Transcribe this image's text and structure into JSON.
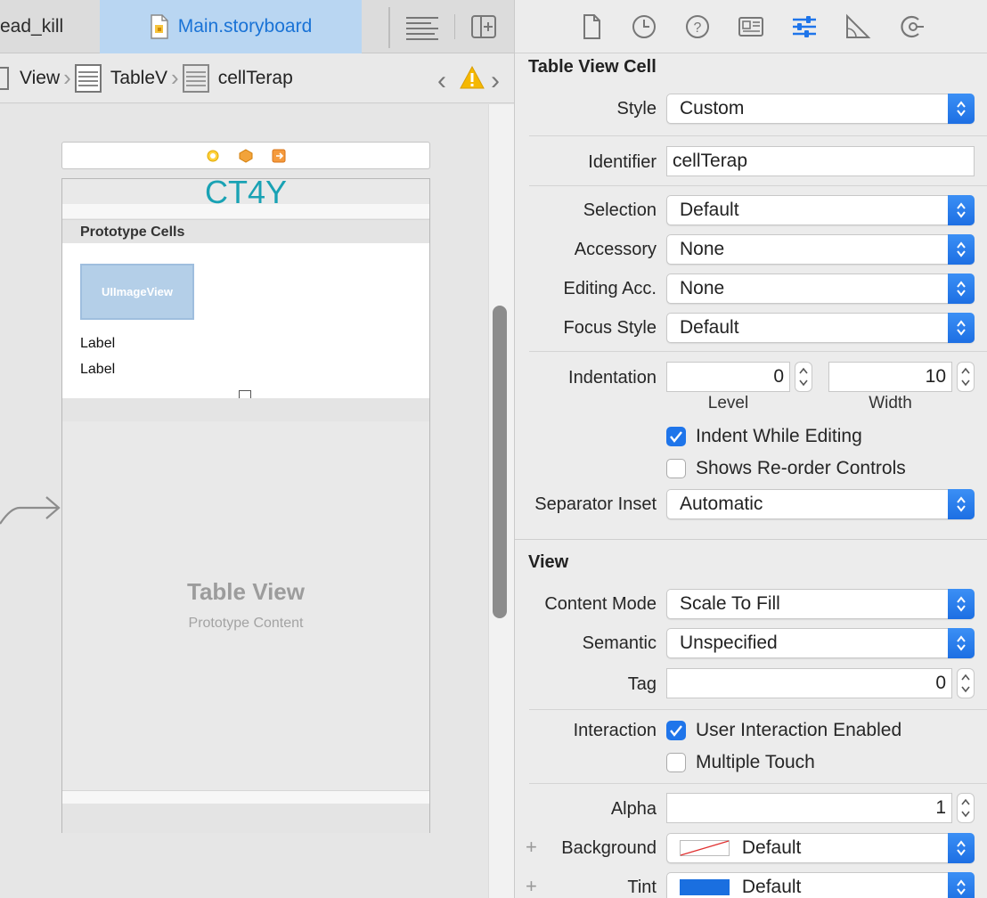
{
  "tabbar": {
    "tab1_label": "ead_kill",
    "tab2_label": "Main.storyboard"
  },
  "jumpbar": {
    "crumbs": [
      "View",
      "TableV",
      "cellTerap"
    ]
  },
  "scene": {
    "nav_title": "CT4Y",
    "section_header": "Prototype Cells",
    "image_view_label": "UIImageView",
    "label1": "Label",
    "label2": "Label",
    "placeholder_title": "Table View",
    "placeholder_subtitle": "Prototype Content"
  },
  "inspector": {
    "cell_section_title": "Table View Cell",
    "style": {
      "label": "Style",
      "value": "Custom"
    },
    "identifier": {
      "label": "Identifier",
      "value": "cellTerap"
    },
    "selection": {
      "label": "Selection",
      "value": "Default"
    },
    "accessory": {
      "label": "Accessory",
      "value": "None"
    },
    "editing_acc": {
      "label": "Editing Acc.",
      "value": "None"
    },
    "focus_style": {
      "label": "Focus Style",
      "value": "Default"
    },
    "indentation": {
      "label": "Indentation",
      "level": "0",
      "width": "10",
      "level_caption": "Level",
      "width_caption": "Width"
    },
    "indent_while_editing": {
      "label": "Indent While Editing",
      "checked": true
    },
    "shows_reorder": {
      "label": "Shows Re-order Controls",
      "checked": false
    },
    "separator_inset": {
      "label": "Separator Inset",
      "value": "Automatic"
    },
    "view_section_title": "View",
    "content_mode": {
      "label": "Content Mode",
      "value": "Scale To Fill"
    },
    "semantic": {
      "label": "Semantic",
      "value": "Unspecified"
    },
    "tag": {
      "label": "Tag",
      "value": "0"
    },
    "interaction": {
      "label": "Interaction",
      "user_interaction": "User Interaction Enabled",
      "multiple_touch": "Multiple Touch"
    },
    "alpha": {
      "label": "Alpha",
      "value": "1"
    },
    "background": {
      "label": "Background",
      "value": "Default"
    },
    "tint": {
      "label": "Tint",
      "value": "Default",
      "color": "#1a6fe0"
    }
  },
  "colors": {
    "accent": "#1f75ea",
    "selected_tab_bg": "#b9d6f2",
    "nav_title": "#19a2b4",
    "warning": "#f5b800"
  }
}
